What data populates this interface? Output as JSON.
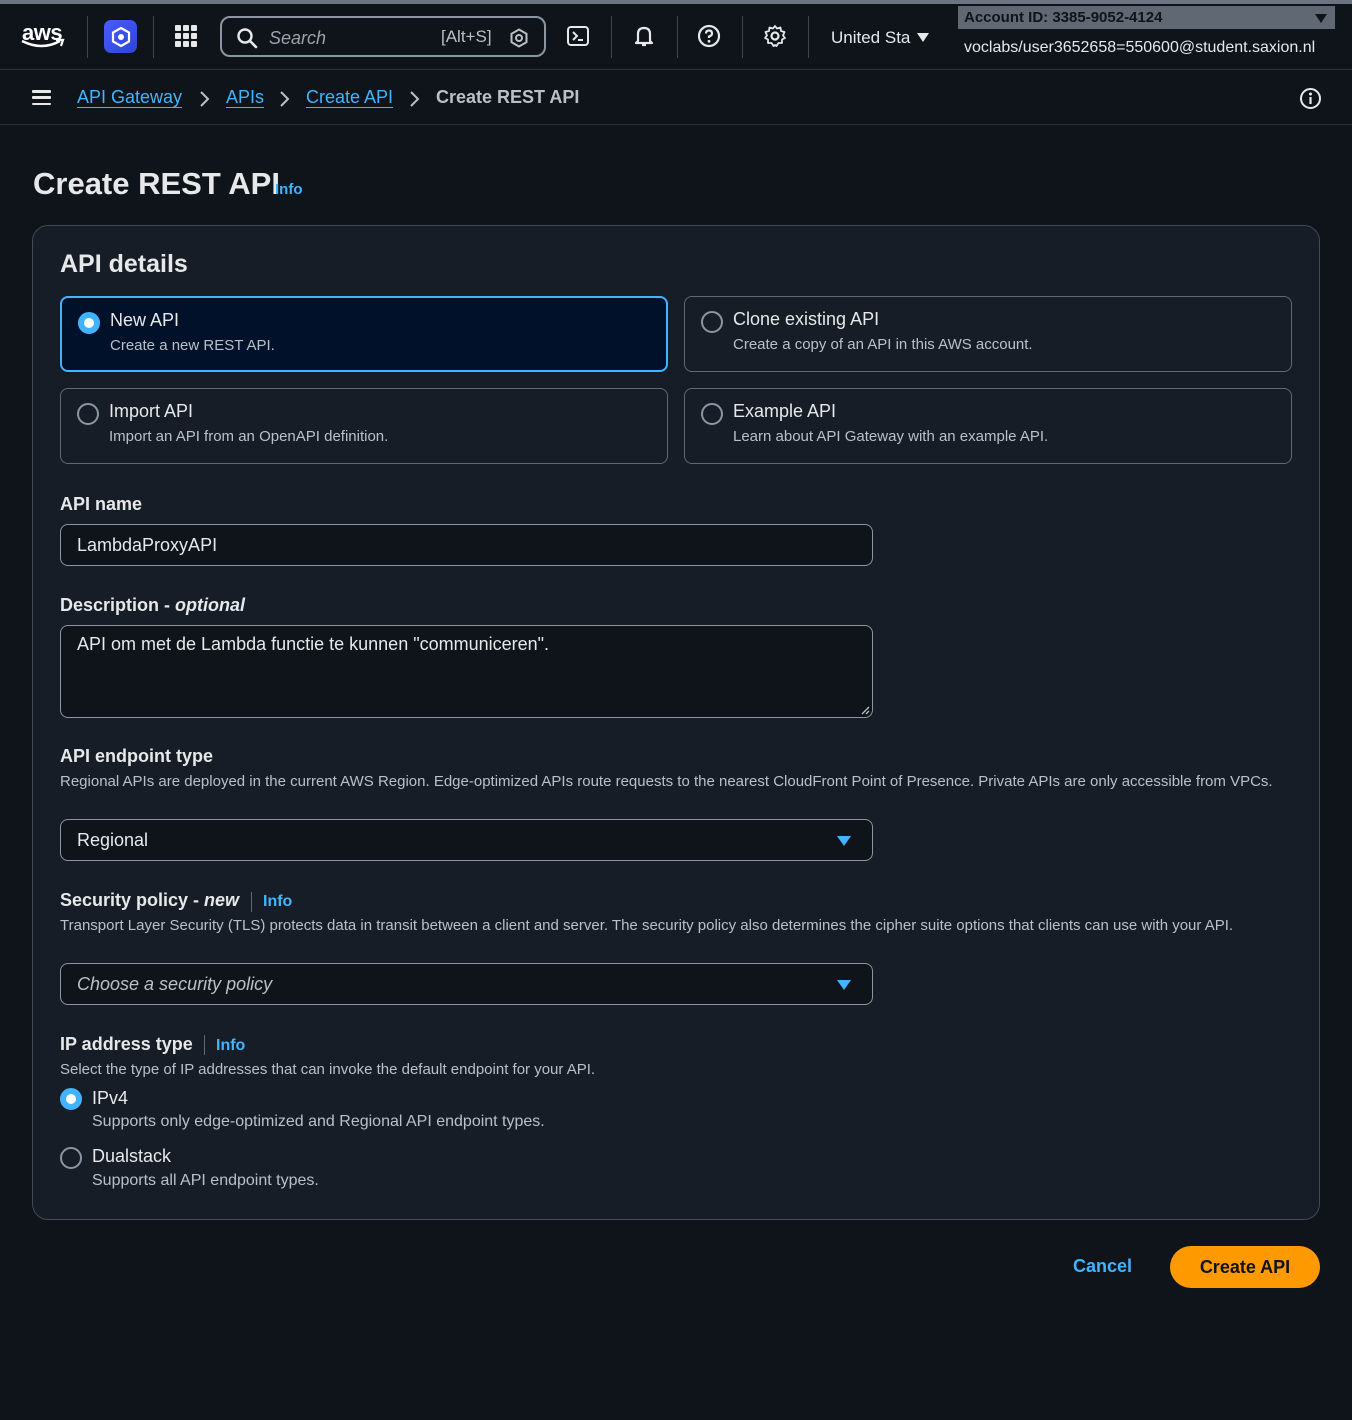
{
  "topnav": {
    "logo_text": "aws",
    "search_placeholder": "Search",
    "search_shortcut": "[Alt+S]",
    "region": "United Sta",
    "account_id": "Account ID: 3385-9052-4124",
    "user": "voclabs/user3652658=550600@student.saxion.nl"
  },
  "breadcrumb": {
    "items": [
      "API Gateway",
      "APIs",
      "Create API"
    ],
    "current": "Create REST API"
  },
  "page": {
    "title": "Create REST API",
    "info": "Info"
  },
  "details": {
    "heading": "API details",
    "options": [
      {
        "title": "New API",
        "desc": "Create a new REST API.",
        "selected": true
      },
      {
        "title": "Clone existing API",
        "desc": "Create a copy of an API in this AWS account.",
        "selected": false
      },
      {
        "title": "Import API",
        "desc": "Import an API from an OpenAPI definition.",
        "selected": false
      },
      {
        "title": "Example API",
        "desc": "Learn about API Gateway with an example API.",
        "selected": false
      }
    ],
    "api_name": {
      "label": "API name",
      "value": "LambdaProxyAPI"
    },
    "description": {
      "label": "Description - ",
      "label_optional": "optional",
      "value": "API om met de Lambda functie te kunnen \"communiceren\"."
    },
    "endpoint": {
      "label": "API endpoint type",
      "desc": "Regional APIs are deployed in the current AWS Region. Edge-optimized APIs route requests to the nearest CloudFront Point of Presence. Private APIs are only accessible from VPCs.",
      "value": "Regional"
    },
    "security": {
      "label": "Security policy - ",
      "label_new": "new",
      "info": "Info",
      "desc": "Transport Layer Security (TLS) protects data in transit between a client and server. The security policy also determines the cipher suite options that clients can use with your API.",
      "placeholder": "Choose a security policy"
    },
    "ip": {
      "label": "IP address type",
      "info": "Info",
      "desc": "Select the type of IP addresses that can invoke the default endpoint for your API.",
      "options": [
        {
          "title": "IPv4",
          "desc": "Supports only edge-optimized and Regional API endpoint types.",
          "selected": true
        },
        {
          "title": "Dualstack",
          "desc": "Supports all API endpoint types.",
          "selected": false
        }
      ]
    }
  },
  "actions": {
    "cancel": "Cancel",
    "create": "Create API"
  },
  "colors": {
    "accent": "#42b4ff",
    "primary_button": "#ff9900",
    "background": "#0f141a"
  }
}
